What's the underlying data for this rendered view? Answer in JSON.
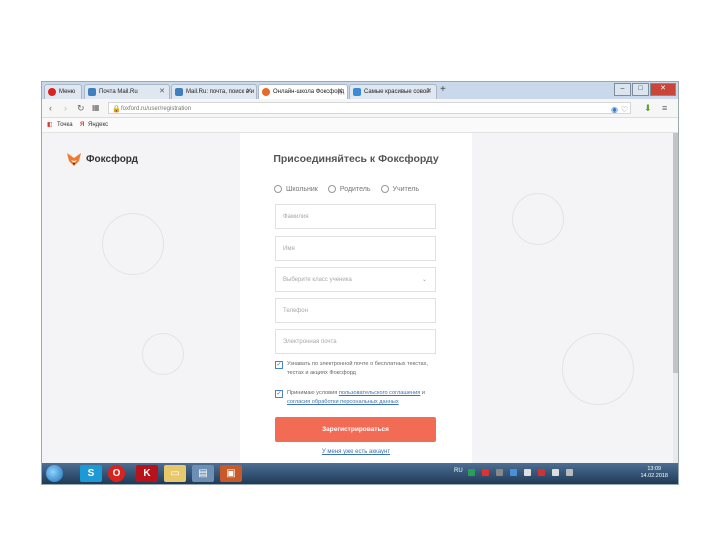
{
  "browser": {
    "tabs": [
      {
        "label": "Меню",
        "icon": "opera-icon",
        "color": "#d9231e"
      },
      {
        "label": "Почта Mail.Ru",
        "icon": "mail-icon",
        "color": "#3f7fbf"
      },
      {
        "label": "Mail.Ru: почта, поиск в и",
        "icon": "mail-icon",
        "color": "#3f7fbf"
      },
      {
        "label": "Онлайн-школа Фоксфорд",
        "icon": "fox-icon",
        "color": "#e86a2a"
      },
      {
        "label": "Самые красивые совой",
        "icon": "puzzle-icon",
        "color": "#3a8ad6"
      }
    ],
    "new_tab": "+",
    "address": "foxford.ru/user/registration",
    "bookmarks": [
      "Точка",
      "Яндекс"
    ]
  },
  "page": {
    "logo_text": "Фоксфорд",
    "title": "Присоединяйтесь к Фоксфорду",
    "roles": [
      "Школьник",
      "Родитель",
      "Учитель"
    ],
    "fields": {
      "lastname_placeholder": "Фамилия",
      "firstname_placeholder": "Имя",
      "grade_select": "Выберите класс ученика",
      "phone_placeholder": "Телефон",
      "email_placeholder": "Электронная почта"
    },
    "checkbox_news": "Узнавать по электронной почте о бесплатных текстах, тестах и акциях Фоксфорд",
    "checkbox_terms_prefix": "Принимаю условия",
    "checkbox_terms_link1": "пользовательского соглашения",
    "checkbox_terms_and": "и",
    "checkbox_terms_link2": "согласия обработки персональных данных",
    "submit_label": "Зарегистрироваться",
    "have_account": "У меня уже есть аккаунт"
  },
  "taskbar": {
    "clock_time": "13:09",
    "clock_date": "14.02.2018",
    "lang": "RU"
  },
  "colors": {
    "accent": "#f26b55",
    "link": "#3a72b8"
  }
}
